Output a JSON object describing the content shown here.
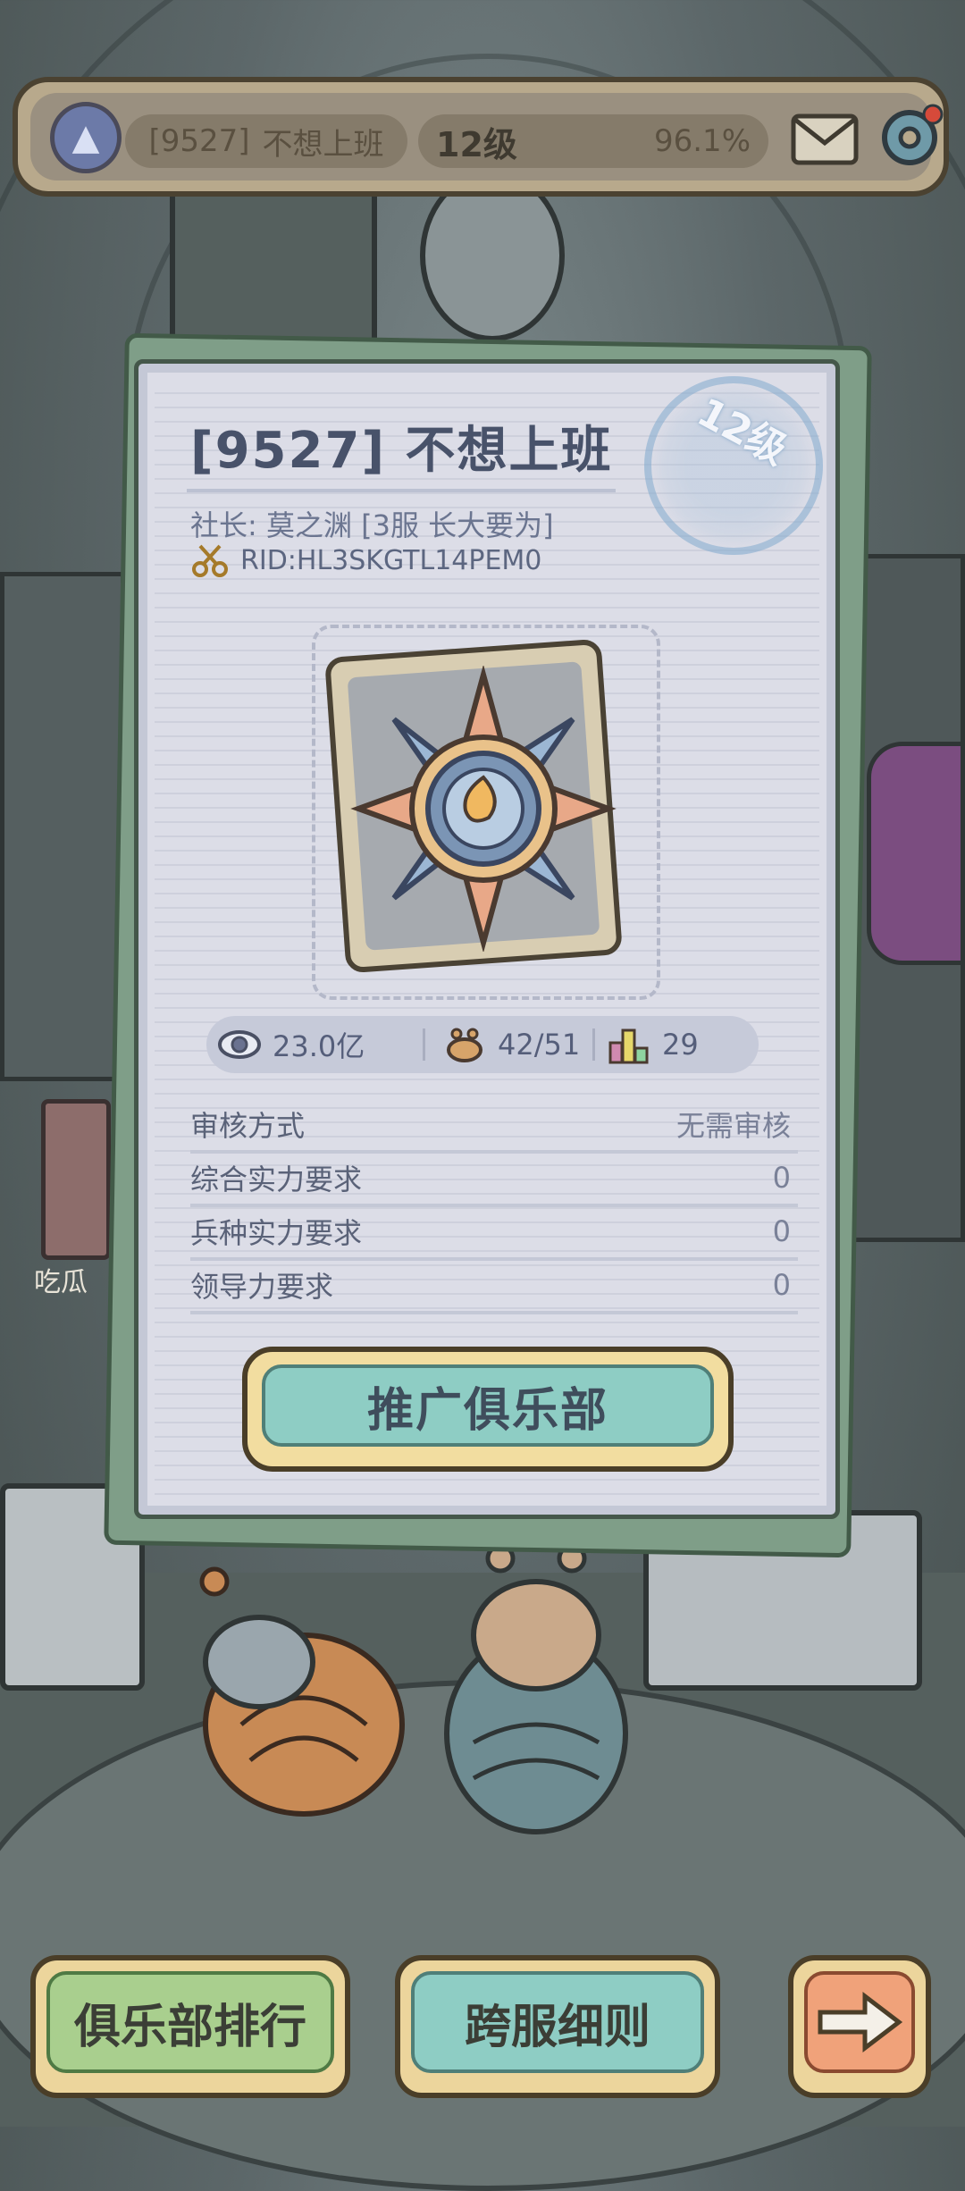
{
  "top_bar": {
    "club_tag": "[9527]",
    "club_name": "不想上班",
    "level": "12级",
    "progress": "96.1%"
  },
  "card": {
    "stamp_level": "12级",
    "title": "[9527] 不想上班",
    "leader": "社长: 莫之渊 [3服 长大要为]",
    "rid": "RID:HL3SKGTL14PEM0",
    "stats": {
      "views": "23.0亿",
      "members": "42/51",
      "rank": "29"
    },
    "requirements": [
      {
        "label": "审核方式",
        "value": "无需审核"
      },
      {
        "label": "综合实力要求",
        "value": "0"
      },
      {
        "label": "兵种实力要求",
        "value": "0"
      },
      {
        "label": "领导力要求",
        "value": "0"
      }
    ],
    "promote_button": "推广俱乐部"
  },
  "side": {
    "label": "吃瓜"
  },
  "bottom": {
    "rank_button": "俱乐部排行",
    "rules_button": "跨服细则"
  },
  "colors": {
    "card_bg": "#dcdde7",
    "button_teal": "#8ecdc4",
    "button_green": "#a9cf8e",
    "button_orange": "#f0a27a"
  }
}
